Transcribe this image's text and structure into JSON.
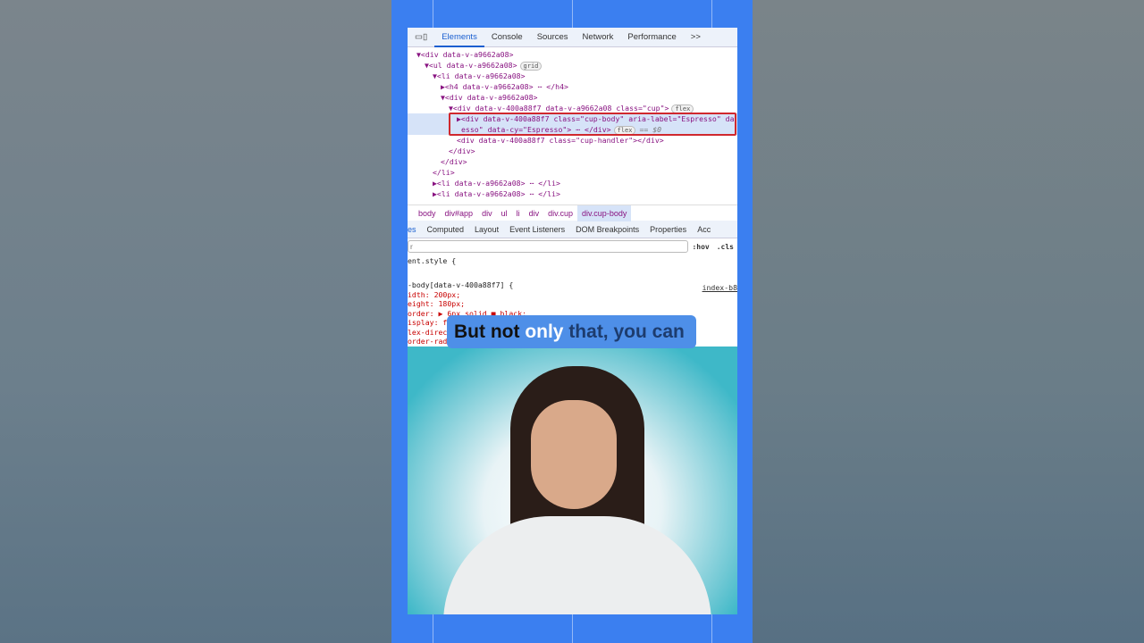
{
  "devtools": {
    "tabs": [
      "Elements",
      "Console",
      "Sources",
      "Network",
      "Performance",
      ">>"
    ],
    "tree": [
      {
        "indent": 0,
        "text": "▼<div data-v-a9662a08>"
      },
      {
        "indent": 1,
        "text": "▼<ul data-v-a9662a08>",
        "badge": "grid"
      },
      {
        "indent": 2,
        "text": "▼<li data-v-a9662a08>"
      },
      {
        "indent": 3,
        "text": "▶<h4 data-v-a9662a08> ⋯ </h4>"
      },
      {
        "indent": 3,
        "text": "▼<div data-v-a9662a08>"
      },
      {
        "indent": 4,
        "text": "▼<div data-v-400a88f7 data-v-a9662a08 class=\"cup\">",
        "badge": "flex"
      },
      {
        "indent": 5,
        "text": "▶<div data-v-400a88f7 class=\"cup-body\" aria-label=\"Espresso\" da",
        "selected": true
      },
      {
        "indent": 5,
        "text": "esso\" data-cy=\"Espresso\"> ⋯ </div>",
        "badge": "flex",
        "suffix": "== $0",
        "selected": true
      },
      {
        "indent": 5,
        "text": "<div data-v-400a88f7 class=\"cup-handler\"></div>"
      },
      {
        "indent": 4,
        "text": "</div>"
      },
      {
        "indent": 3,
        "text": "</div>"
      },
      {
        "indent": 2,
        "text": "</li>"
      },
      {
        "indent": 2,
        "text": "▶<li data-v-a9662a08> ⋯ </li>"
      },
      {
        "indent": 2,
        "text": "▶<li data-v-a9662a08> ⋯ </li>"
      }
    ],
    "breadcrumb": [
      "body",
      "div#app",
      "div",
      "ul",
      "li",
      "div",
      "div.cup",
      "div.cup-body"
    ],
    "subtabs": [
      "es",
      "Computed",
      "Layout",
      "Event Listeners",
      "DOM Breakpoints",
      "Properties",
      "Acc"
    ],
    "filter_placeholder": "r",
    "hov": ":hov",
    "cls": ".cls",
    "css_lines": [
      "ent.style {",
      "",
      "-body[data-v-400a88f7] {",
      "idth: 200px;",
      "eight: 180px;",
      "order: ▶ 6px solid ■ black;",
      "isplay: f",
      "lex-direc",
      "order-rad"
    ],
    "source_link": "index-b8"
  },
  "caption": {
    "part1": "But not ",
    "part2": "only",
    "part3": " that, you can"
  },
  "colors": {
    "panel": "#3b7ff0",
    "highlight": "#d0282e",
    "caption_bg": "#4e8fe8"
  }
}
